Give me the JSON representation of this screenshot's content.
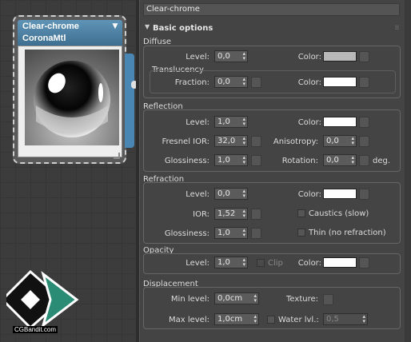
{
  "node": {
    "title": "Clear-chrome",
    "subtitle": "CoronaMtl",
    "watermark": "CGBandit.com"
  },
  "name_field": "Clear-chrome",
  "rollout": {
    "title": "Basic options"
  },
  "diffuse": {
    "group": "Diffuse",
    "level_label": "Level:",
    "level": "0,0",
    "color_label": "Color:",
    "color": "#b8b8b8",
    "translucency": "Translucency",
    "fraction_label": "Fraction:",
    "fraction": "0,0",
    "tcolor_label": "Color:",
    "tcolor": "#ffffff"
  },
  "reflection": {
    "group": "Reflection",
    "level_label": "Level:",
    "level": "1,0",
    "color_label": "Color:",
    "color": "#ffffff",
    "fresnel_label": "Fresnel IOR:",
    "fresnel": "32,0",
    "aniso_label": "Anisotropy:",
    "aniso": "0,0",
    "gloss_label": "Glossiness:",
    "gloss": "1,0",
    "rotation_label": "Rotation:",
    "rotation": "0,0",
    "deg": "deg."
  },
  "refraction": {
    "group": "Refraction",
    "level_label": "Level:",
    "level": "0,0",
    "color_label": "Color:",
    "color": "#ffffff",
    "ior_label": "IOR:",
    "ior": "1,52",
    "caustics": "Caustics (slow)",
    "gloss_label": "Glossiness:",
    "gloss": "1,0",
    "thin": "Thin (no refraction)"
  },
  "opacity": {
    "group": "Opacity",
    "level_label": "Level:",
    "level": "1,0",
    "clip": "Clip",
    "color_label": "Color:",
    "color": "#ffffff"
  },
  "displacement": {
    "group": "Displacement",
    "min_label": "Min level:",
    "min": "0,0cm",
    "texture_label": "Texture:",
    "max_label": "Max level:",
    "max": "1,0cm",
    "water_label": "Water lvl.:",
    "water": "0,5"
  }
}
